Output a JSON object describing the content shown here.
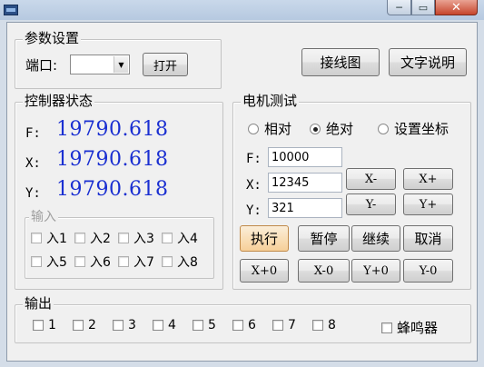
{
  "window": {
    "title": "",
    "controls": {
      "minimize": "─",
      "maximize": "▭",
      "close": "✕"
    }
  },
  "params": {
    "legend": "参数设置",
    "port_label": "端口:",
    "port_value": "",
    "open_button": "打开"
  },
  "top_buttons": {
    "wiring": "接线图",
    "help_text": "文字说明"
  },
  "status": {
    "legend": "控制器状态",
    "rows": [
      {
        "label": "F:",
        "value": "19790.618"
      },
      {
        "label": "X:",
        "value": "19790.618"
      },
      {
        "label": "Y:",
        "value": "19790.618"
      }
    ],
    "inputs": {
      "legend": "输入",
      "items": [
        "入1",
        "入2",
        "入3",
        "入4",
        "入5",
        "入6",
        "入7",
        "入8"
      ]
    }
  },
  "motor": {
    "legend": "电机测试",
    "mode": {
      "options": [
        "相对",
        "绝对",
        "设置坐标"
      ],
      "selected": "绝对"
    },
    "fields": [
      {
        "label": "F:",
        "value": "10000"
      },
      {
        "label": "X:",
        "value": "12345"
      },
      {
        "label": "Y:",
        "value": "321"
      }
    ],
    "jog": {
      "x_minus": "X-",
      "x_plus": "X+",
      "y_minus": "Y-",
      "y_plus": "Y+"
    },
    "actions": {
      "execute": "执行",
      "pause": "暂停",
      "resume": "继续",
      "cancel": "取消"
    },
    "zero": {
      "x_plus0": "X+0",
      "x_minus0": "X-0",
      "y_plus0": "Y+0",
      "y_minus0": "Y-0"
    }
  },
  "output": {
    "legend": "输出",
    "items": [
      "1",
      "2",
      "3",
      "4",
      "5",
      "6",
      "7",
      "8"
    ],
    "buzzer": "蜂鸣器"
  }
}
